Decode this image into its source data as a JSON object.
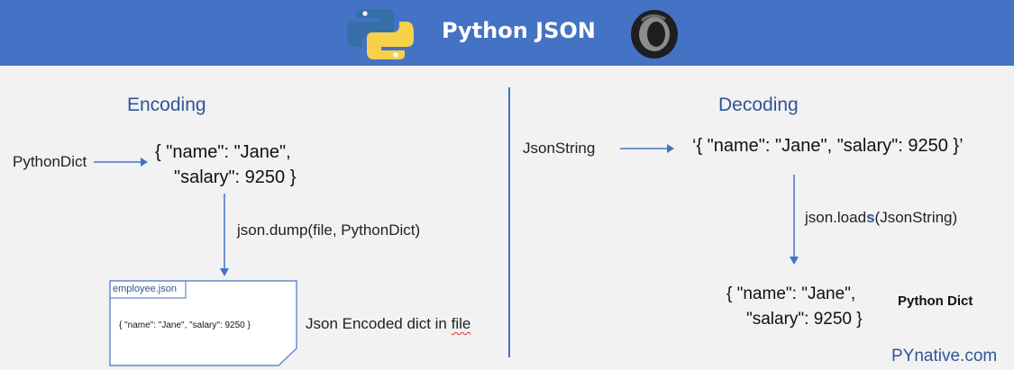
{
  "header": {
    "title": "Python JSON",
    "background_color": "#4472c4",
    "left_logo": "python-logo",
    "right_logo": "json-logo"
  },
  "encoding": {
    "title": "Encoding",
    "input_label": "PythonDict",
    "dict_line1": "{ \"name\": \"Jane\",",
    "dict_line2": "\"salary\": 9250 }",
    "function_label": "json.dump(file, PythonDict)",
    "file": {
      "name": "employee.json",
      "content": "{ \"name\": \"Jane\",  \"salary\": 9250 }"
    },
    "file_caption_pre": "Json Encoded dict in ",
    "file_caption_word": "file"
  },
  "decoding": {
    "title": "Decoding",
    "input_label": "JsonString",
    "string_value": "‘{ \"name\": \"Jane\", \"salary\": 9250 }’",
    "function_pre": "json.load",
    "function_highlight": "s",
    "function_post": "(JsonString)",
    "result_line1": "{ \"name\": \"Jane\",",
    "result_line2": "\"salary\": 9250 }",
    "result_label": "Python Dict"
  },
  "brand": "PYnative.com",
  "colors": {
    "accent": "#4472c4",
    "section_title": "#2f5597",
    "background": "#f2f2f2"
  }
}
